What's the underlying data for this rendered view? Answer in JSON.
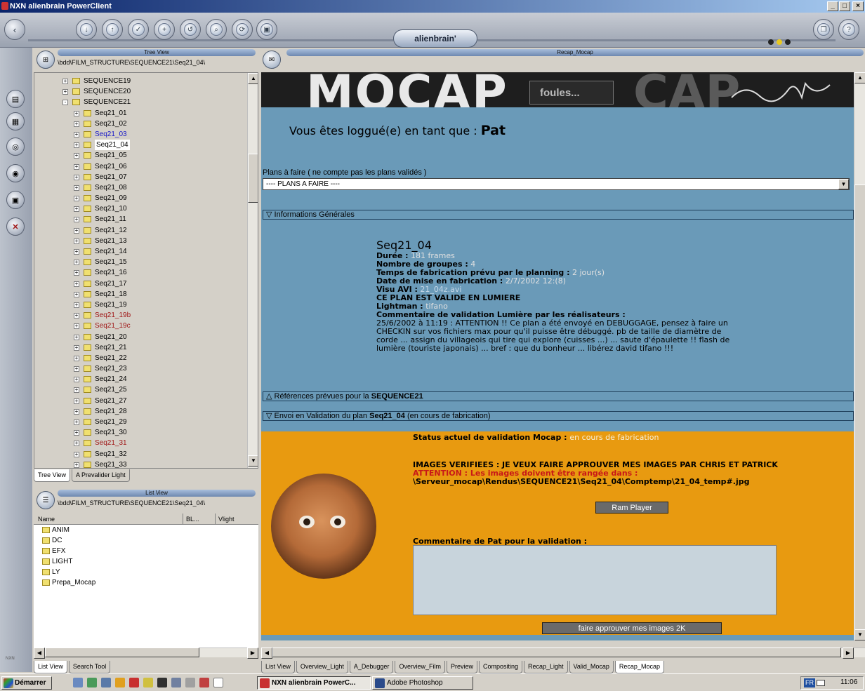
{
  "window": {
    "title": "NXN alienbrain PowerClient",
    "minimize": "_",
    "maximize": "□",
    "close": "×"
  },
  "toolbar": {
    "brand": "alienbrain'"
  },
  "tree_view": {
    "header": "Tree View",
    "path": "\\bdd\\FILM_STRUCTURE\\SEQUENCE21\\Seq21_04\\",
    "items": [
      {
        "label": "SEQUENCE19",
        "level": 1,
        "exp": "+",
        "color": "#000000"
      },
      {
        "label": "SEQUENCE20",
        "level": 1,
        "exp": "+",
        "color": "#000000"
      },
      {
        "label": "SEQUENCE21",
        "level": 1,
        "exp": "-",
        "color": "#000000"
      },
      {
        "label": "Seq21_01",
        "level": 2,
        "exp": "+",
        "color": "#000000"
      },
      {
        "label": "Seq21_02",
        "level": 2,
        "exp": "+",
        "color": "#000000"
      },
      {
        "label": "Seq21_03",
        "level": 2,
        "exp": "+",
        "color": "#1818c8"
      },
      {
        "label": "Seq21_04",
        "level": 2,
        "exp": "+",
        "color": "#000000",
        "selected": true
      },
      {
        "label": "Seq21_05",
        "level": 2,
        "exp": "+",
        "color": "#000000"
      },
      {
        "label": "Seq21_06",
        "level": 2,
        "exp": "+",
        "color": "#000000"
      },
      {
        "label": "Seq21_07",
        "level": 2,
        "exp": "+",
        "color": "#000000"
      },
      {
        "label": "Seq21_08",
        "level": 2,
        "exp": "+",
        "color": "#000000"
      },
      {
        "label": "Seq21_09",
        "level": 2,
        "exp": "+",
        "color": "#000000"
      },
      {
        "label": "Seq21_10",
        "level": 2,
        "exp": "+",
        "color": "#000000"
      },
      {
        "label": "Seq21_11",
        "level": 2,
        "exp": "+",
        "color": "#000000"
      },
      {
        "label": "Seq21_12",
        "level": 2,
        "exp": "+",
        "color": "#000000"
      },
      {
        "label": "Seq21_13",
        "level": 2,
        "exp": "+",
        "color": "#000000"
      },
      {
        "label": "Seq21_14",
        "level": 2,
        "exp": "+",
        "color": "#000000"
      },
      {
        "label": "Seq21_15",
        "level": 2,
        "exp": "+",
        "color": "#000000"
      },
      {
        "label": "Seq21_16",
        "level": 2,
        "exp": "+",
        "color": "#000000"
      },
      {
        "label": "Seq21_17",
        "level": 2,
        "exp": "+",
        "color": "#000000"
      },
      {
        "label": "Seq21_18",
        "level": 2,
        "exp": "+",
        "color": "#000000"
      },
      {
        "label": "Seq21_19",
        "level": 2,
        "exp": "+",
        "color": "#000000"
      },
      {
        "label": "Seq21_19b",
        "level": 2,
        "exp": "+",
        "color": "#a01818"
      },
      {
        "label": "Seq21_19c",
        "level": 2,
        "exp": "+",
        "color": "#a01818"
      },
      {
        "label": "Seq21_20",
        "level": 2,
        "exp": "+",
        "color": "#000000"
      },
      {
        "label": "Seq21_21",
        "level": 2,
        "exp": "+",
        "color": "#000000"
      },
      {
        "label": "Seq21_22",
        "level": 2,
        "exp": "+",
        "color": "#000000"
      },
      {
        "label": "Seq21_23",
        "level": 2,
        "exp": "+",
        "color": "#000000"
      },
      {
        "label": "Seq21_24",
        "level": 2,
        "exp": "+",
        "color": "#000000"
      },
      {
        "label": "Seq21_25",
        "level": 2,
        "exp": "+",
        "color": "#000000"
      },
      {
        "label": "Seq21_27",
        "level": 2,
        "exp": "+",
        "color": "#000000"
      },
      {
        "label": "Seq21_28",
        "level": 2,
        "exp": "+",
        "color": "#000000"
      },
      {
        "label": "Seq21_29",
        "level": 2,
        "exp": "+",
        "color": "#000000"
      },
      {
        "label": "Seq21_30",
        "level": 2,
        "exp": "+",
        "color": "#000000"
      },
      {
        "label": "Seq21_31",
        "level": 2,
        "exp": "+",
        "color": "#a01818"
      },
      {
        "label": "Seq21_32",
        "level": 2,
        "exp": "+",
        "color": "#000000"
      },
      {
        "label": "Seq21_33",
        "level": 2,
        "exp": "+",
        "color": "#000000"
      }
    ],
    "tabs": [
      "Tree View",
      "A Prevalider Light"
    ]
  },
  "list_view": {
    "header": "List View",
    "path": "\\bdd\\FILM_STRUCTURE\\SEQUENCE21\\Seq21_04\\",
    "columns": [
      "Name",
      "BL...",
      "Vlight"
    ],
    "items": [
      "ANIM",
      "DC",
      "EFX",
      "LIGHT",
      "LY",
      "Prepa_Mocap"
    ],
    "tabs": [
      "List View",
      "Search Tool"
    ]
  },
  "recap": {
    "header": "Recap_Mocap",
    "banner_title": "MOCAP",
    "banner_subtitle": "foules...",
    "banner_ghost": "CAP",
    "login_prefix": "Vous êtes loggué(e) en tant que :",
    "login_user": "Pat",
    "plans_label": "Plans à faire ( ne compte pas les plans validés )",
    "plans_select": "---- PLANS A FAIRE ----",
    "section_general": "Informations Générales",
    "seq_title": "Seq21_04",
    "duree_label": "Durée :",
    "duree_value": "181 frames",
    "groupes_label": "Nombre de groupes :",
    "groupes_value": "4",
    "temps_label": "Temps de fabrication prévu par le planning :",
    "temps_value": "2 jour(s)",
    "date_label": "Date de mise en fabrication :",
    "date_value": "2/7/2002 12:(8)",
    "visu_label": "Visu AVI :",
    "visu_value": "21_04z.avi",
    "valide_text": "CE PLAN EST VALIDE EN LUMIERE",
    "lightman_label": "Lightman :",
    "lightman_value": "tifano",
    "comment_label": "Commentaire de validation Lumière par les réalisateurs :",
    "comment_text": "25/6/2002 à 11:19 : ATTENTION !! Ce plan a été envoyé en DEBUGGAGE, pensez à faire un CHECKIN sur vos fichiers max pour qu'il puisse être débuggé. pb de taille de diamètre de corde ... assign du villageois qui tire qui explore (cuisses ...) ... saute d'épaulette !! flash de lumière (touriste japonais) ... bref : que du bonheur ... libérez david tifano !!!",
    "section_refs_prefix": "Références prévues pour la",
    "section_refs_seq": "SEQUENCE21",
    "section_envoi_prefix": "Envoi en Validation du plan",
    "section_envoi_plan": "Seq21_04",
    "section_envoi_suffix": "(en cours de fabrication)",
    "status_label": "Status actuel de validation Mocap :",
    "status_value": "en cours de fabrication",
    "images_line": "IMAGES VERIFIEES : JE VEUX FAIRE APPROUVER MES IMAGES PAR CHRIS ET PATRICK",
    "attention_line": "ATTENTION : Les images doivent être rangée dans :",
    "path_line": "\\Serveur_mocap\\Rendus\\SEQUENCE21\\Seq21_04\\Comptemp\\21_04_temp#.jpg",
    "ram_button": "Ram Player",
    "comment_pat_label": "Commentaire de Pat pour la validation :",
    "comment_pat_value": "",
    "approve_button": "faire approuver mes images 2K"
  },
  "bottom_tabs": [
    "List View",
    "Overview_Light",
    "A_Debugger",
    "Overview_Film",
    "Preview",
    "Compositing",
    "Recap_Light",
    "Valid_Mocap",
    "Recap_Mocap"
  ],
  "taskbar": {
    "start": "Démarrer",
    "task1": "NXN alienbrain PowerC...",
    "task2": "Adobe Photoshop",
    "lang": "FR",
    "clock": "11:06"
  },
  "colors": {
    "content_bg": "#6a9ab8",
    "orange_bg": "#e89a10",
    "highlight_value": "#e0e0e0",
    "attention_red": "#c81818"
  }
}
